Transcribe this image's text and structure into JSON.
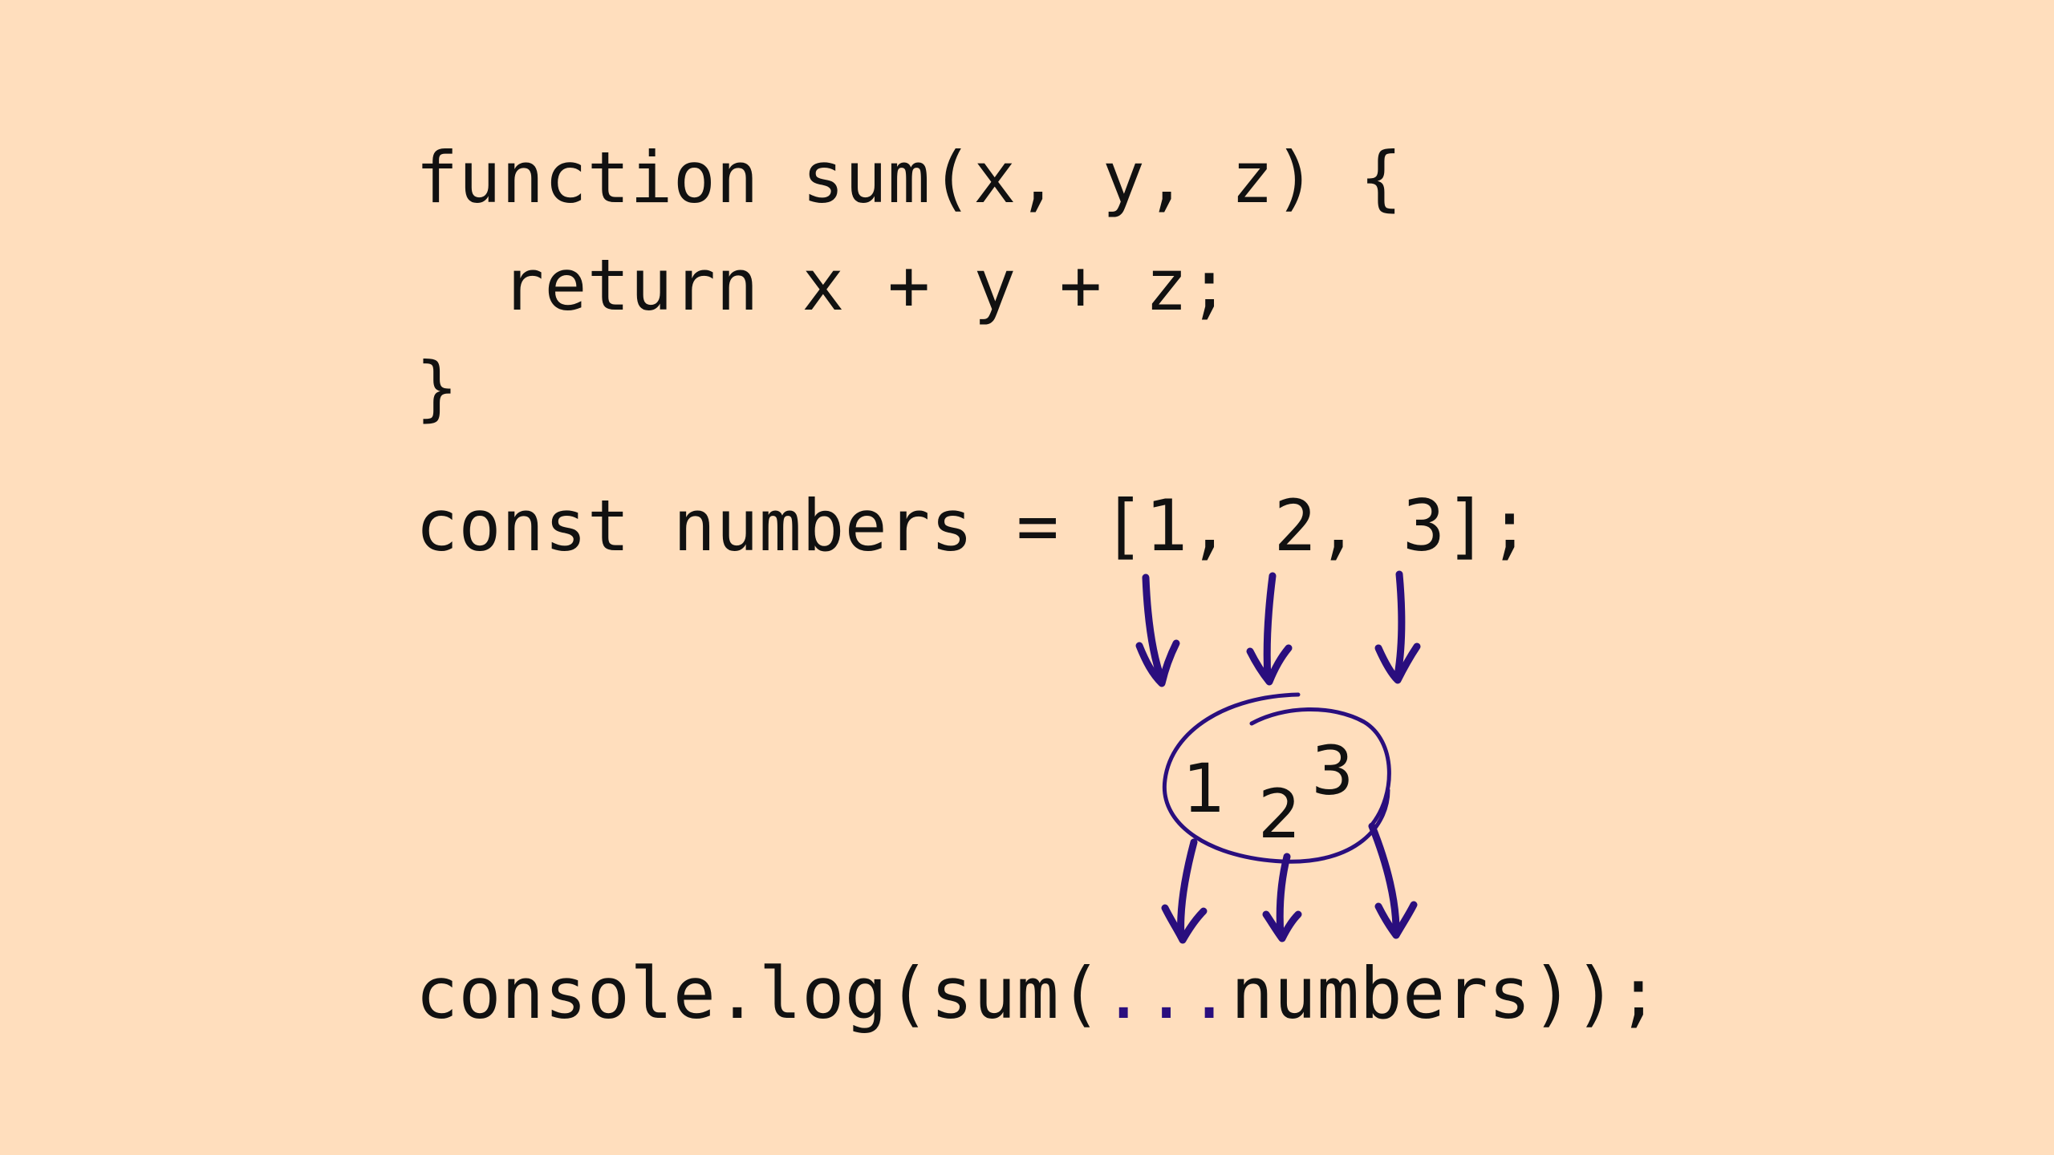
{
  "code": {
    "line1": "function sum(x, y, z) {",
    "line2": "  return x + y + z;",
    "line3": "}",
    "line4": "const numbers = [1, 2, 3];",
    "line5_prefix": "console.log(sum(",
    "line5_spread": "...",
    "line5_suffix": "numbers));"
  },
  "bubble": {
    "digit_1": "1",
    "digit_2": "2",
    "digit_3": "3"
  },
  "colors": {
    "background": "#FFDEBD",
    "text": "#111111",
    "accent": "#2A0E7E"
  }
}
